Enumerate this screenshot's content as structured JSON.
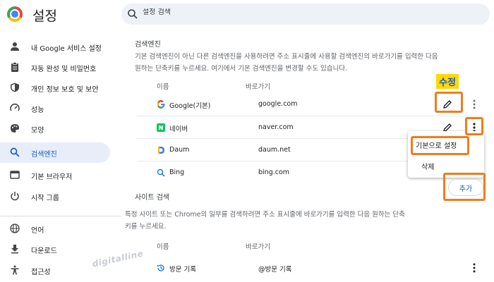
{
  "header": {
    "title": "설정",
    "search_placeholder": "설정 검색"
  },
  "sidebar": {
    "items": [
      {
        "label": "내 Google 서비스 설정",
        "icon": "person-icon"
      },
      {
        "label": "자동 완성 및 비밀번호",
        "icon": "clipboard-icon"
      },
      {
        "label": "개인 정보 보호 및 보안",
        "icon": "shield-icon"
      },
      {
        "label": "성능",
        "icon": "speedometer-icon"
      },
      {
        "label": "모양",
        "icon": "palette-icon"
      },
      {
        "label": "검색엔진",
        "icon": "search-icon",
        "active": true
      },
      {
        "label": "기본 브라우저",
        "icon": "browser-icon"
      },
      {
        "label": "시작 그룹",
        "icon": "power-icon"
      },
      {
        "label": "언어",
        "icon": "globe-icon"
      },
      {
        "label": "다운로드",
        "icon": "download-icon"
      },
      {
        "label": "접근성",
        "icon": "accessibility-icon"
      }
    ]
  },
  "search_engines": {
    "title": "검색엔진",
    "description_line1": "기본 검색엔진이 아닌 다른 검색엔진을 사용하려면 주소 표시줄에 사용할 검색엔진의 바로가기를 입력한 다음",
    "description_line2": "원하는 단축키를 누르세요. 여기에서 기본 검색엔진을 변경할 수도 있습니다.",
    "col_name": "이름",
    "col_shortcut": "바로가기",
    "rows": [
      {
        "name": "Google(기본)",
        "shortcut": "google.com",
        "icon": "google-icon"
      },
      {
        "name": "네이버",
        "shortcut": "naver.com",
        "icon": "naver-icon"
      },
      {
        "name": "Daum",
        "shortcut": "daum.net",
        "icon": "daum-icon"
      },
      {
        "name": "Bing",
        "shortcut": "bing.com",
        "icon": "bing-icon"
      }
    ]
  },
  "site_search": {
    "title": "사이트 검색",
    "description_line1": "특정 사이트 또는 Chrome의 일부를 검색하려면 주소 표시줄에 바로가기를 입력한 다음 원하는 단축",
    "description_line2": "키를 누르세요.",
    "col_name": "이름",
    "col_shortcut": "바로가기",
    "add_label": "추가",
    "rows": [
      {
        "name": "방문 기록",
        "shortcut": "@방문 기록",
        "icon": "history-icon"
      }
    ]
  },
  "popup_menu": {
    "items": [
      "기본으로 설정",
      "삭제"
    ]
  },
  "annotation": {
    "edit_label": "수정"
  },
  "watermark": "digitalline",
  "colors": {
    "accent": "#1a57c9",
    "active_bg": "#e8eef9",
    "highlight_border": "#f07d1b",
    "label_bg": "#ffd800"
  }
}
